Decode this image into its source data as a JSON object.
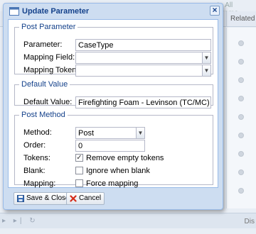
{
  "background": {
    "top_right_text": "ate All Parame",
    "column_header": "Related",
    "footer_text": "Dis",
    "pager_glyphs": "▸ ▸| ↻"
  },
  "dialog": {
    "title": "Update Parameter",
    "close_glyph": "×",
    "post_parameter": {
      "legend": "Post Parameter",
      "parameter_label": "Parameter:",
      "parameter_value": "CaseType",
      "mapping_field_label": "Mapping Field:",
      "mapping_field_value": "",
      "mapping_token_label": "Mapping Token:",
      "mapping_token_value": ""
    },
    "default_value": {
      "legend": "Default Value",
      "label": "Default Value:",
      "value": "Firefighting Foam - Levinson (TC/MC) - ELG - Shield"
    },
    "post_method": {
      "legend": "Post Method",
      "method_label": "Method:",
      "method_value": "Post",
      "order_label": "Order:",
      "order_value": "0",
      "tokens_label": "Tokens:",
      "tokens_option": "Remove empty tokens",
      "tokens_checked": true,
      "blank_label": "Blank:",
      "blank_option": "Ignore when blank",
      "blank_checked": false,
      "mapping_label": "Mapping:",
      "mapping_option": "Force mapping",
      "mapping_checked": false
    },
    "buttons": {
      "save": "Save & Close",
      "cancel": "Cancel"
    }
  }
}
